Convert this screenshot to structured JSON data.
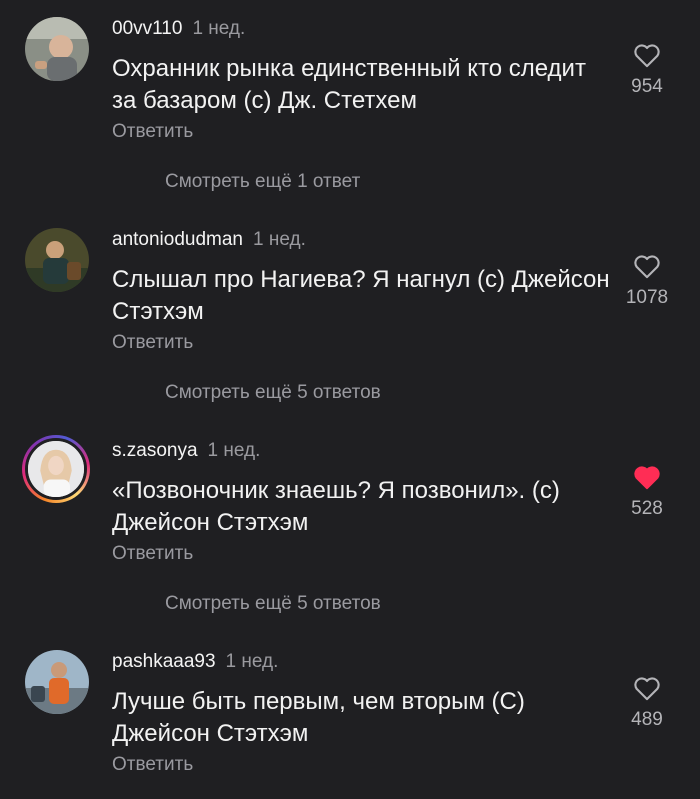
{
  "colors": {
    "background": "#1f1f22",
    "liked": "#ff2d55",
    "muted": "#9a9aa0"
  },
  "comments": [
    {
      "username": "00vv110",
      "time": "1 нед.",
      "text": "Охранник рынка единственный кто следит за базаром (с) Дж. Стетхем",
      "reply_label": "Ответить",
      "likes": "954",
      "liked": false,
      "more_replies": "Смотреть ещё 1 ответ"
    },
    {
      "username": "antoniodudman",
      "time": "1 нед.",
      "text": "Слышал про Нагиева? Я нагнул (с) Джейсон Стэтхэм",
      "reply_label": "Ответить",
      "likes": "1078",
      "liked": false,
      "more_replies": "Смотреть ещё 5 ответов"
    },
    {
      "username": "s.zasonya",
      "time": "1 нед.",
      "text": "«Позвоночник знаешь? Я позвонил». (с) Джейсон Стэтхэм",
      "reply_label": "Ответить",
      "likes": "528",
      "liked": true,
      "more_replies": "Смотреть ещё 5 ответов"
    },
    {
      "username": "pashkaaa93",
      "time": "1 нед.",
      "text": "Лучше быть первым, чем вторым (С) Джейсон Стэтхэм",
      "reply_label": "Ответить",
      "likes": "489",
      "liked": false
    }
  ]
}
